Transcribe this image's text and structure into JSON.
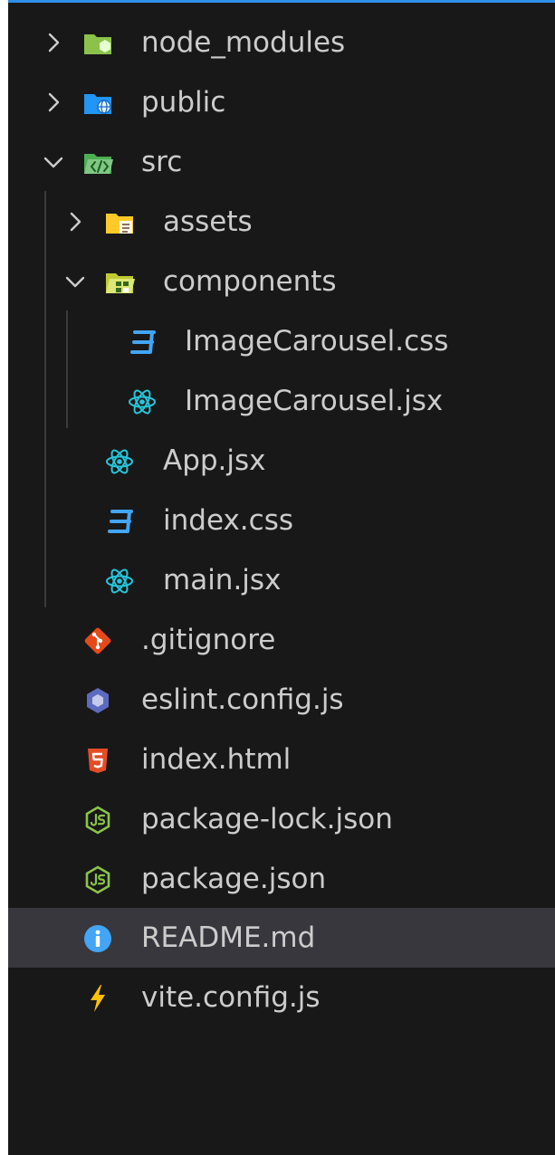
{
  "explorer": {
    "colors": {
      "background": "#181818",
      "text": "#cccccc",
      "selected_row": "#37373d",
      "accent_top_border": "#2f8fe6"
    },
    "tree": [
      {
        "name": "folder-node-modules",
        "label": "node_modules",
        "type": "folder",
        "expanded": false,
        "icon": "folder-node-icon",
        "icon_color": "#8bc34a"
      },
      {
        "name": "folder-public",
        "label": "public",
        "type": "folder",
        "expanded": false,
        "icon": "folder-public-icon",
        "icon_color": "#2196f3"
      },
      {
        "name": "folder-src",
        "label": "src",
        "type": "folder",
        "expanded": true,
        "icon": "folder-src-icon",
        "icon_color": "#4caf50"
      },
      {
        "name": "folder-assets",
        "label": "assets",
        "type": "folder",
        "expanded": false,
        "icon": "folder-assets-icon",
        "icon_color": "#ffca28"
      },
      {
        "name": "folder-components",
        "label": "components",
        "type": "folder",
        "expanded": true,
        "icon": "folder-components-icon",
        "icon_color": "#c0ca33"
      },
      {
        "name": "file-imagecarousel-css",
        "label": "ImageCarousel.css",
        "type": "file",
        "icon": "css-icon",
        "icon_color": "#42a5f5"
      },
      {
        "name": "file-imagecarousel-jsx",
        "label": "ImageCarousel.jsx",
        "type": "file",
        "icon": "react-icon",
        "icon_color": "#26c6da"
      },
      {
        "name": "file-app-jsx",
        "label": "App.jsx",
        "type": "file",
        "icon": "react-icon",
        "icon_color": "#26c6da"
      },
      {
        "name": "file-index-css",
        "label": "index.css",
        "type": "file",
        "icon": "css-icon",
        "icon_color": "#42a5f5"
      },
      {
        "name": "file-main-jsx",
        "label": "main.jsx",
        "type": "file",
        "icon": "react-icon",
        "icon_color": "#26c6da"
      },
      {
        "name": "file-gitignore",
        "label": ".gitignore",
        "type": "file",
        "icon": "git-icon",
        "icon_color": "#e64a19"
      },
      {
        "name": "file-eslint-config",
        "label": "eslint.config.js",
        "type": "file",
        "icon": "eslint-icon",
        "icon_color": "#5c6bc0"
      },
      {
        "name": "file-index-html",
        "label": "index.html",
        "type": "file",
        "icon": "html-icon",
        "icon_color": "#e44d26"
      },
      {
        "name": "file-package-lock",
        "label": "package-lock.json",
        "type": "file",
        "icon": "nodejs-icon",
        "icon_color": "#8bc34a"
      },
      {
        "name": "file-package-json",
        "label": "package.json",
        "type": "file",
        "icon": "nodejs-icon",
        "icon_color": "#8bc34a"
      },
      {
        "name": "file-readme",
        "label": "README.md",
        "type": "file",
        "icon": "info-icon",
        "icon_color": "#42a5f5",
        "selected": true
      },
      {
        "name": "file-vite-config",
        "label": "vite.config.js",
        "type": "file",
        "icon": "vite-icon",
        "icon_color": "#ffc107"
      }
    ]
  }
}
